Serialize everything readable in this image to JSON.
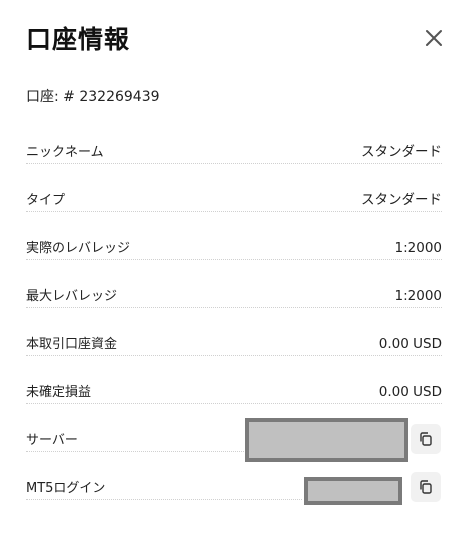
{
  "header": {
    "title": "口座情報",
    "close_icon": "close-icon"
  },
  "account": {
    "label": "口座: # 232269439"
  },
  "rows": [
    {
      "label": "ニックネーム",
      "value": "スタンダード"
    },
    {
      "label": "タイプ",
      "value": "スタンダード"
    },
    {
      "label": "実際のレバレッジ",
      "value": "1:2000"
    },
    {
      "label": "最大レバレッジ",
      "value": "1:2000"
    },
    {
      "label": "本取引口座資金",
      "value": "0.00 USD"
    },
    {
      "label": "未確定損益",
      "value": "0.00 USD"
    }
  ],
  "server": {
    "label": "サーバー",
    "copy_icon": "copy-icon"
  },
  "login": {
    "label": "MT5ログイン",
    "copy_icon": "copy-icon"
  },
  "colors": {
    "mask_fill": "#c0c0c0",
    "mask_border": "#7a7a7a",
    "copy_bg": "#f1f1f1"
  }
}
